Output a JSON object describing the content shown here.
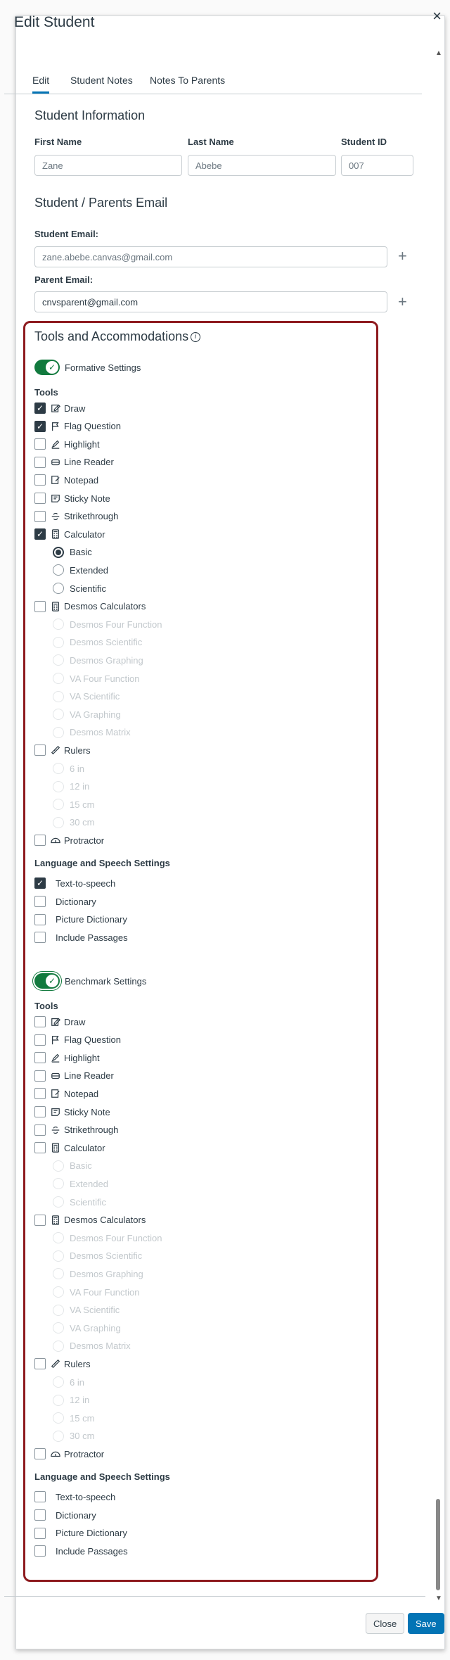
{
  "modal": {
    "title": "Edit Student",
    "close": "×"
  },
  "tabs": [
    "Edit",
    "Student Notes",
    "Notes To Parents"
  ],
  "student_info": {
    "heading": "Student Information",
    "first_name_label": "First Name",
    "first_name_placeholder": "Zane",
    "last_name_label": "Last Name",
    "last_name_placeholder": "Abebe",
    "student_id_label": "Student ID",
    "student_id_placeholder": "007"
  },
  "emails": {
    "heading": "Student / Parents Email",
    "student_label": "Student Email:",
    "student_placeholder": "zane.abebe.canvas@gmail.com",
    "parent_label": "Parent Email:",
    "parent_value": "cnvsparent@gmail.com"
  },
  "tools_heading": "Tools and Accommodations",
  "info_icon": "i",
  "formative": {
    "toggle_label": "Formative Settings",
    "tools_heading": "Tools",
    "tools": {
      "draw": {
        "label": "Draw",
        "checked": true
      },
      "flag": {
        "label": "Flag Question",
        "checked": true
      },
      "highlight": {
        "label": "Highlight",
        "checked": false
      },
      "line_reader": {
        "label": "Line Reader",
        "checked": false
      },
      "notepad": {
        "label": "Notepad",
        "checked": false
      },
      "sticky": {
        "label": "Sticky Note",
        "checked": false
      },
      "strike": {
        "label": "Strikethrough",
        "checked": false
      },
      "calculator": {
        "label": "Calculator",
        "checked": true
      },
      "calc_basic": "Basic",
      "calc_extended": "Extended",
      "calc_scientific": "Scientific",
      "desmos": {
        "label": "Desmos Calculators",
        "checked": false
      },
      "desmos_options": [
        "Desmos Four Function",
        "Desmos Scientific",
        "Desmos Graphing",
        "VA Four Function",
        "VA Scientific",
        "VA Graphing",
        "Desmos Matrix"
      ],
      "rulers": {
        "label": "Rulers",
        "checked": false
      },
      "ruler_options": [
        "6 in",
        "12 in",
        "15 cm",
        "30 cm"
      ],
      "protractor": {
        "label": "Protractor",
        "checked": false
      }
    },
    "lang_heading": "Language and Speech Settings",
    "lang": {
      "tts": {
        "label": "Text-to-speech",
        "checked": true
      },
      "dictionary": {
        "label": "Dictionary",
        "checked": false
      },
      "picture_dictionary": {
        "label": "Picture Dictionary",
        "checked": false
      },
      "include_passages": {
        "label": "Include Passages",
        "checked": false
      }
    }
  },
  "benchmark": {
    "toggle_label": "Benchmark Settings",
    "tools_heading": "Tools",
    "tools": {
      "draw": {
        "label": "Draw",
        "checked": false
      },
      "flag": {
        "label": "Flag Question",
        "checked": false
      },
      "highlight": {
        "label": "Highlight",
        "checked": false
      },
      "line_reader": {
        "label": "Line Reader",
        "checked": false
      },
      "notepad": {
        "label": "Notepad",
        "checked": false
      },
      "sticky": {
        "label": "Sticky Note",
        "checked": false
      },
      "strike": {
        "label": "Strikethrough",
        "checked": false
      },
      "calculator": {
        "label": "Calculator",
        "checked": false
      },
      "calc_basic": "Basic",
      "calc_extended": "Extended",
      "calc_scientific": "Scientific",
      "desmos": {
        "label": "Desmos Calculators",
        "checked": false
      },
      "desmos_options": [
        "Desmos Four Function",
        "Desmos Scientific",
        "Desmos Graphing",
        "VA Four Function",
        "VA Scientific",
        "VA Graphing",
        "Desmos Matrix"
      ],
      "rulers": {
        "label": "Rulers",
        "checked": false
      },
      "ruler_options": [
        "6 in",
        "12 in",
        "15 cm",
        "30 cm"
      ],
      "protractor": {
        "label": "Protractor",
        "checked": false
      }
    },
    "lang_heading": "Language and Speech Settings",
    "lang": {
      "tts": {
        "label": "Text-to-speech",
        "checked": false
      },
      "dictionary": {
        "label": "Dictionary",
        "checked": false
      },
      "picture_dictionary": {
        "label": "Picture Dictionary",
        "checked": false
      },
      "include_passages": {
        "label": "Include Passages",
        "checked": false
      }
    }
  },
  "footer": {
    "cancel": "Close",
    "save": "Save"
  },
  "colors": {
    "accent": "#0374b5",
    "toggle_on": "#127a3e",
    "highlight_border": "#8e1b1f"
  }
}
